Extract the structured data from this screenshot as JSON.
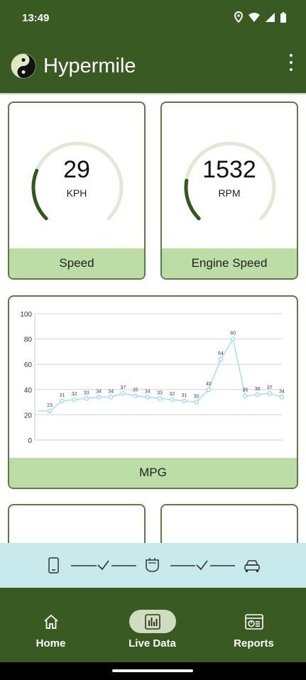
{
  "status": {
    "time": "13:49"
  },
  "appbar": {
    "title": "Hypermile"
  },
  "gauges": [
    {
      "value": "29",
      "unit": "KPH",
      "label": "Speed",
      "level": 0.25
    },
    {
      "value": "1532",
      "unit": "RPM",
      "label": "Engine Speed",
      "level": 0.2
    }
  ],
  "mpg_card": {
    "label": "MPG"
  },
  "chart_data": {
    "type": "line",
    "title": "",
    "xlabel": "",
    "ylabel": "",
    "ylim": [
      0,
      100
    ],
    "yticks": [
      0,
      20,
      40,
      60,
      80,
      100
    ],
    "grid": true,
    "legend": "none",
    "series": [
      {
        "color": "#8fdaf2",
        "values": [
          23,
          23,
          31,
          32,
          33,
          34,
          34,
          37,
          35,
          34,
          33,
          32,
          31,
          30,
          40,
          64,
          80,
          35,
          36,
          37,
          34
        ],
        "data_labels": [
          "",
          "23",
          "31",
          "32",
          "33",
          "34",
          "34",
          "37",
          "35",
          "34",
          "33",
          "32",
          "31",
          "30",
          "40",
          "64",
          "80",
          "35",
          "36",
          "37",
          "34"
        ]
      }
    ]
  },
  "connection": {
    "icons": [
      "phone-icon",
      "obd-adapter-icon",
      "car-icon"
    ],
    "steps": [
      "check-icon",
      "check-icon"
    ]
  },
  "nav": {
    "items": [
      {
        "label": "Home",
        "icon": "home-icon"
      },
      {
        "label": "Live Data",
        "icon": "chart-icon",
        "active": true
      },
      {
        "label": "Reports",
        "icon": "reports-icon"
      }
    ]
  },
  "colors": {
    "primary": "#3a5a24",
    "card_border": "#5c7a48",
    "card_footer": "#bcdea6",
    "gauge_track": "#dfe9d3",
    "gauge_fill": "#2f5a1c",
    "line": "#8fdaf2",
    "connection_bar": "#c8eaec",
    "nav_active": "#cfdcbf"
  }
}
